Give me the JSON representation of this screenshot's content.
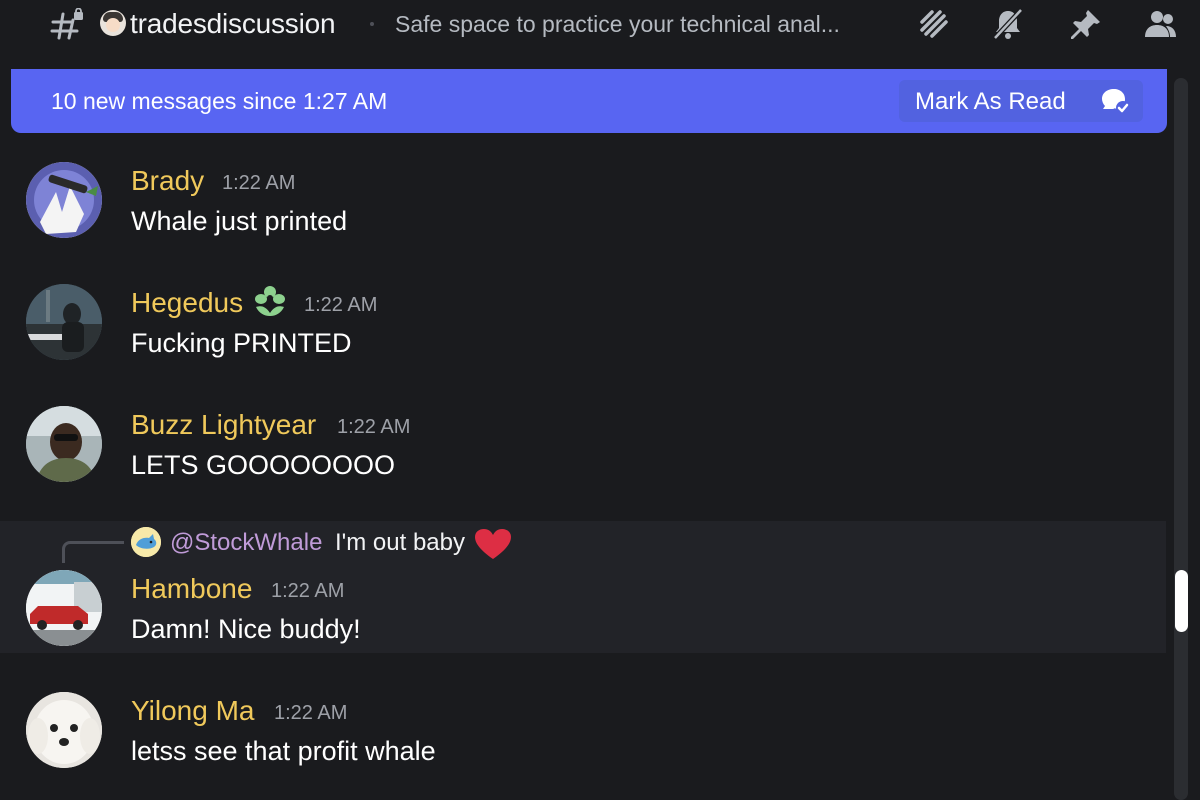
{
  "header": {
    "channel_name": "tradesdiscussion",
    "topic": "Safe space to practice your technical anal...",
    "icons": [
      "threads-icon",
      "mute-bell-icon",
      "pin-icon",
      "members-icon"
    ]
  },
  "banner": {
    "text": "10 new messages since 1:27 AM",
    "mark_as_read": "Mark As Read",
    "color": "#5865f2"
  },
  "messages": [
    {
      "author": "Brady",
      "time": "1:22 AM",
      "content": "Whale just printed"
    },
    {
      "author": "Hegedus",
      "time": "1:22 AM",
      "content": "Fucking PRINTED",
      "badge": "flower-badge-icon"
    },
    {
      "author": "Buzz Lightyear",
      "time": "1:22 AM",
      "content": "LETS GOOOOOOOO"
    },
    {
      "author": "Hambone",
      "time": "1:22 AM",
      "content": "Damn! Nice buddy!",
      "reply": {
        "mention": "@StockWhale",
        "text": "I'm out baby",
        "emoji": "heart-icon"
      }
    },
    {
      "author": "Yilong Ma",
      "time": "1:22 AM",
      "content": "letss see that profit whale"
    }
  ],
  "colors": {
    "author": "#f0c95b",
    "mention": "#c09bd8",
    "background": "#1a1b1e"
  }
}
